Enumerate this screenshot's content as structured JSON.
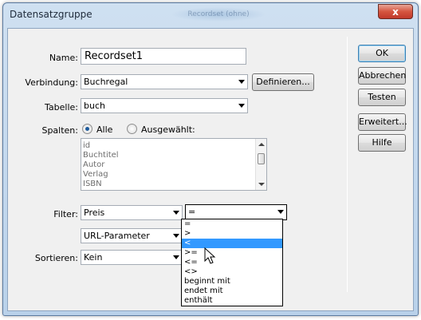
{
  "window": {
    "title": "Datensatzgruppe",
    "title_ghost": "Recordset (ohne)",
    "close_glyph": "x"
  },
  "form": {
    "name": {
      "label": "Name:",
      "value": "Recordset1"
    },
    "verbindung": {
      "label": "Verbindung:",
      "value": "Buchregal",
      "define_button": "Definieren..."
    },
    "tabelle": {
      "label": "Tabelle:",
      "value": "buch"
    },
    "spalten": {
      "label": "Spalten:",
      "option_all": "Alle",
      "option_selected": "Ausgewählt:",
      "selected_option": "Alle",
      "columns": [
        "id",
        "Buchtitel",
        "Autor",
        "Verlag",
        "ISBN"
      ]
    },
    "filter": {
      "label": "Filter:",
      "field": "Preis",
      "operator": "=",
      "parameter_type": "URL-Parameter",
      "operator_options": [
        "=",
        ">",
        "<",
        ">=",
        "<=",
        "<>",
        "beginnt mit",
        "endet mit",
        "enthält"
      ],
      "highlighted_option": "<"
    },
    "sortieren": {
      "label": "Sortieren:",
      "value": "Kein"
    }
  },
  "buttons": {
    "ok": "OK",
    "abbrechen": "Abbrechen",
    "testen": "Testen",
    "erweitert": "Erweitert...",
    "hilfe": "Hilfe"
  },
  "colors": {
    "highlight": "#3399ff",
    "radio_dot": "#1d5a9b",
    "close_button": "#c0392b"
  }
}
